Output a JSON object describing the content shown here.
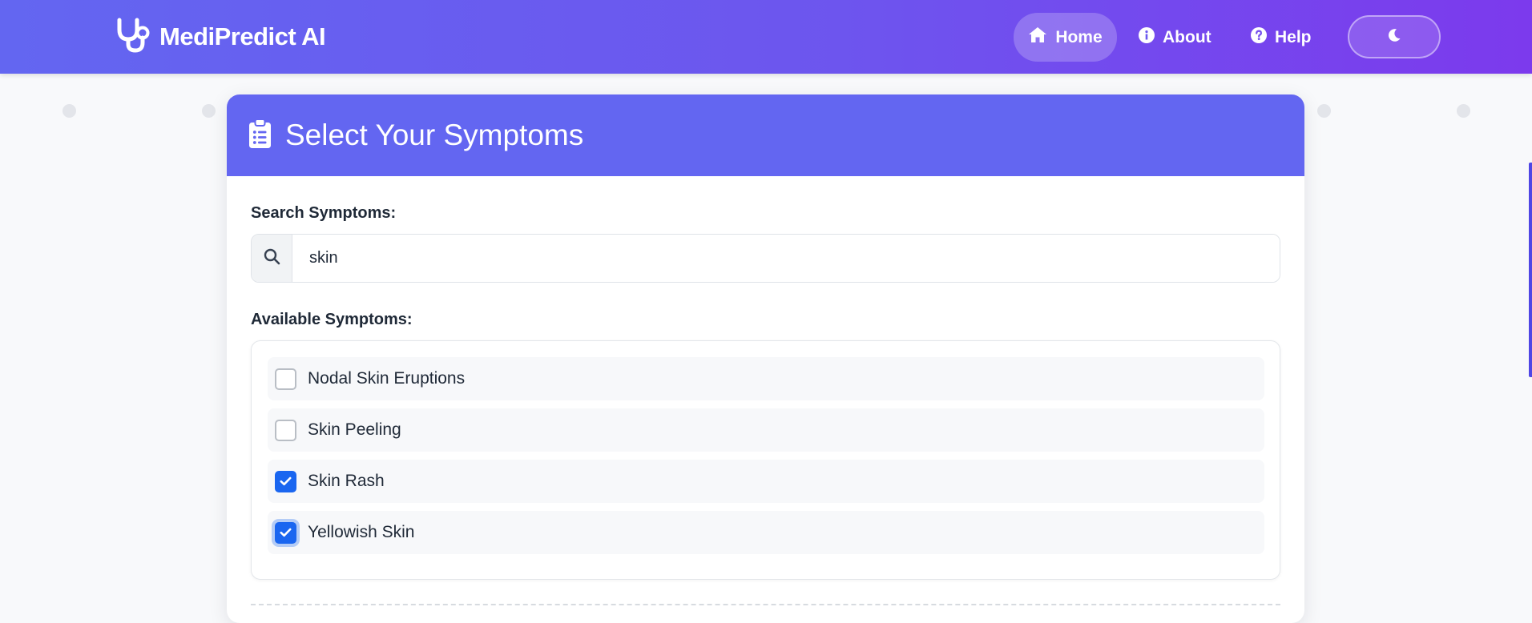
{
  "app": {
    "name": "MediPredict AI"
  },
  "nav": {
    "items": [
      {
        "label": "Home",
        "icon": "home-icon",
        "active": true
      },
      {
        "label": "About",
        "icon": "info-icon",
        "active": false
      },
      {
        "label": "Help",
        "icon": "question-icon",
        "active": false
      }
    ],
    "theme_toggle_icon": "moon-icon"
  },
  "card": {
    "title": "Select Your Symptoms",
    "header_icon": "clipboard-list-icon"
  },
  "search": {
    "label": "Search Symptoms:",
    "value": "skin"
  },
  "symptoms": {
    "label": "Available Symptoms:",
    "items": [
      {
        "label": "Nodal Skin Eruptions",
        "checked": false
      },
      {
        "label": "Skin Peeling",
        "checked": false
      },
      {
        "label": "Skin Rash",
        "checked": true
      },
      {
        "label": "Yellowish Skin",
        "checked": true
      }
    ]
  },
  "colors": {
    "nav_gradient_start": "#6366f1",
    "nav_gradient_end": "#7c3aed",
    "card_header": "#6366f1",
    "checkbox_checked": "#1a66f0"
  }
}
